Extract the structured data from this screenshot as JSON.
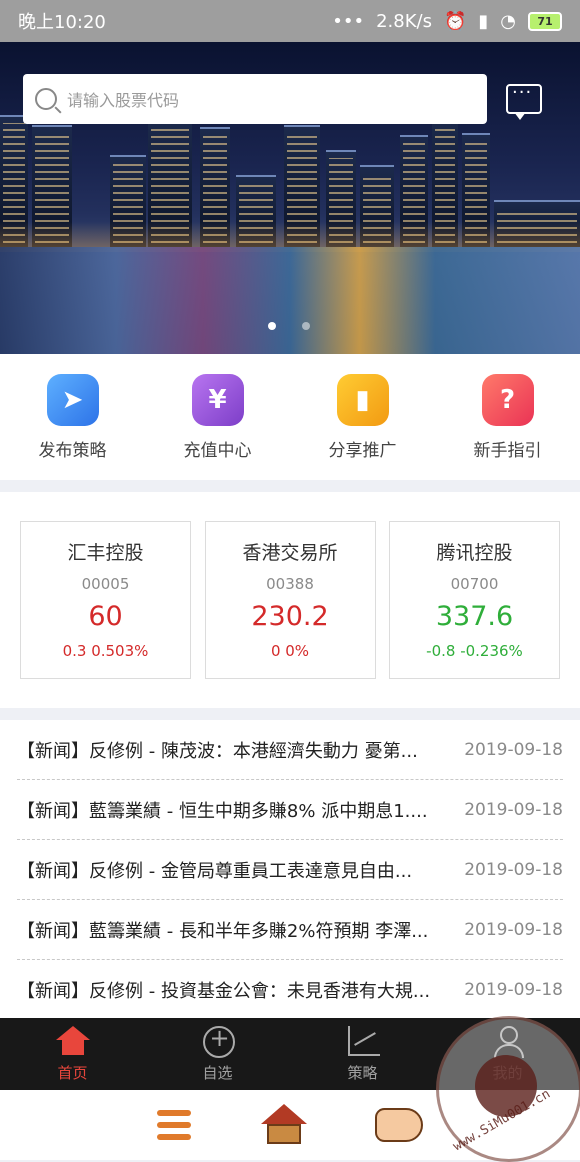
{
  "statusbar": {
    "time": "晚上10:20",
    "net_speed": "2.8K/s",
    "battery": "71"
  },
  "search": {
    "placeholder": "请输入股票代码"
  },
  "quick_menu": [
    {
      "label": "发布策略",
      "icon": "paper-plane-icon",
      "color": "#3f8ef6"
    },
    {
      "label": "充值中心",
      "icon": "yen-icon",
      "color": "#9a55d8"
    },
    {
      "label": "分享推广",
      "icon": "book-icon",
      "color": "#f5a623"
    },
    {
      "label": "新手指引",
      "icon": "question-icon",
      "color": "#f25058"
    }
  ],
  "stocks": [
    {
      "name": "汇丰控股",
      "code": "00005",
      "price": "60",
      "change": "0.3 0.503%",
      "trend": "up"
    },
    {
      "name": "香港交易所",
      "code": "00388",
      "price": "230.2",
      "change": "0 0%",
      "trend": "up"
    },
    {
      "name": "腾讯控股",
      "code": "00700",
      "price": "337.6",
      "change": "-0.8 -0.236%",
      "trend": "down"
    }
  ],
  "news": [
    {
      "title": "【新闻】反修例 - 陳茂波：本港經濟失動力 憂第...",
      "date": "2019-09-18"
    },
    {
      "title": "【新闻】藍籌業績 - 恒生中期多賺8% 派中期息1....",
      "date": "2019-09-18"
    },
    {
      "title": "【新闻】反修例 - 金管局尊重員工表達意見自由...",
      "date": "2019-09-18"
    },
    {
      "title": "【新闻】藍籌業績 - 長和半年多賺2%符預期 李澤...",
      "date": "2019-09-18"
    },
    {
      "title": "【新闻】反修例 - 投資基金公會：未見香港有大規...",
      "date": "2019-09-18"
    }
  ],
  "bottom_nav": [
    {
      "label": "首页",
      "active": true
    },
    {
      "label": "自选",
      "active": false
    },
    {
      "label": "策略",
      "active": false
    },
    {
      "label": "我的",
      "active": false
    }
  ],
  "watermark": {
    "text": "www.SiMu001.cn"
  }
}
